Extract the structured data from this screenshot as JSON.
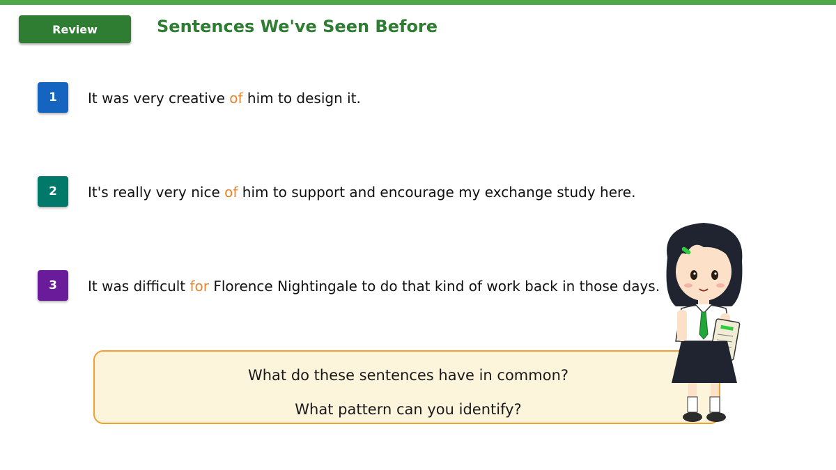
{
  "header": {
    "badge_label": "Review",
    "title": "Sentences We've Seen Before",
    "accent_color": "#4ea84a"
  },
  "sentences": [
    {
      "number": "1",
      "badge_color": "#1565c0",
      "before": "It was very creative ",
      "preposition": "of",
      "after": " him to design it."
    },
    {
      "number": "2",
      "badge_color": "#00796b",
      "before": "It's really very nice ",
      "preposition": "of",
      "after": " him to support and encourage my exchange study here."
    },
    {
      "number": "3",
      "badge_color": "#6a1b9a",
      "before": "It was difficult ",
      "preposition": "for",
      "after": " Florence Nightingale to do that kind of work back in those days."
    }
  ],
  "question_box": {
    "line1": "What do these sentences have in common?",
    "line2": "What pattern can you identify?"
  },
  "illustration": {
    "icon": "student-girl-holding-book-icon"
  },
  "colors": {
    "preposition": "#e7842e",
    "box_fill": "#fdf4dc",
    "box_border": "#f0a030"
  }
}
